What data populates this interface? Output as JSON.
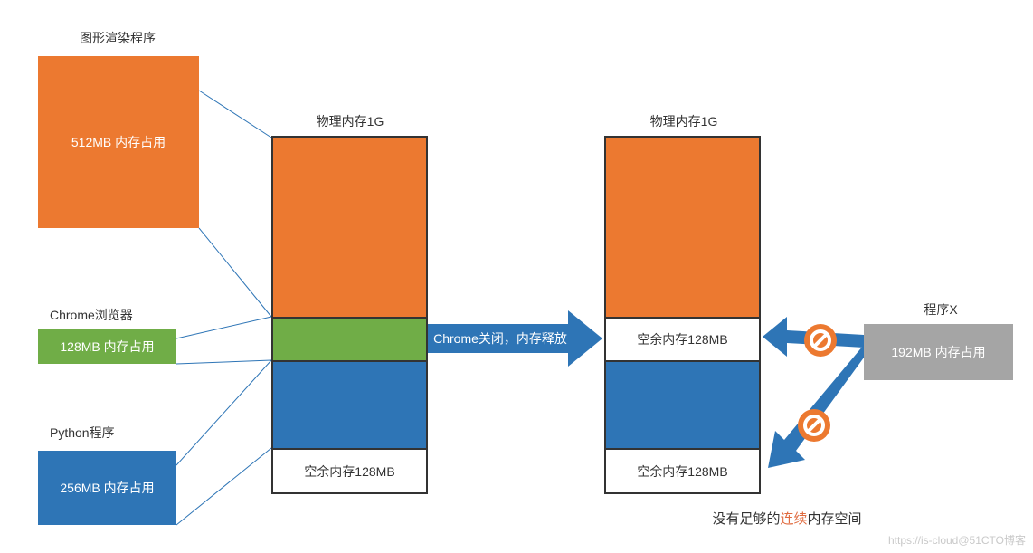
{
  "labels": {
    "renderer_title": "图形渲染程序",
    "chrome_title": "Chrome浏览器",
    "python_title": "Python程序",
    "col1_title": "物理内存1G",
    "col2_title": "物理内存1G",
    "programx_title": "程序X",
    "renderer_mem": "512MB 内存占用",
    "chrome_mem": "128MB 内存占用",
    "python_mem": "256MB 内存占用",
    "programx_mem": "192MB 内存占用",
    "free128_a": "空余内存128MB",
    "free128_b": "空余内存128MB",
    "free128_c": "空余内存128MB",
    "arrow_label": "Chrome关闭，内存释放",
    "footer_prefix": "没有足够的",
    "footer_em": "连续",
    "footer_suffix": "内存空间",
    "watermark": "https://is-cloud@51CTO博客"
  },
  "colors": {
    "orange": "#ec7930",
    "green": "#70ad47",
    "blue": "#2e75b6",
    "gray": "#a5a5a5",
    "accent_red": "#e06b3f"
  },
  "chart_data": {
    "type": "bar",
    "title": "物理内存分配示意（单位：MB，总 1024MB）",
    "before": [
      {
        "name": "图形渲染程序",
        "size_mb": 512,
        "color": "orange"
      },
      {
        "name": "Chrome浏览器",
        "size_mb": 128,
        "color": "green"
      },
      {
        "name": "Python程序",
        "size_mb": 256,
        "color": "blue"
      },
      {
        "name": "空余内存",
        "size_mb": 128,
        "color": "white"
      }
    ],
    "after": [
      {
        "name": "图形渲染程序",
        "size_mb": 512,
        "color": "orange"
      },
      {
        "name": "空余内存",
        "size_mb": 128,
        "color": "white"
      },
      {
        "name": "Python程序",
        "size_mb": 256,
        "color": "blue"
      },
      {
        "name": "空余内存",
        "size_mb": 128,
        "color": "white"
      }
    ],
    "incoming_request": {
      "name": "程序X",
      "size_mb": 192,
      "result": "fail_no_contiguous_block"
    }
  }
}
